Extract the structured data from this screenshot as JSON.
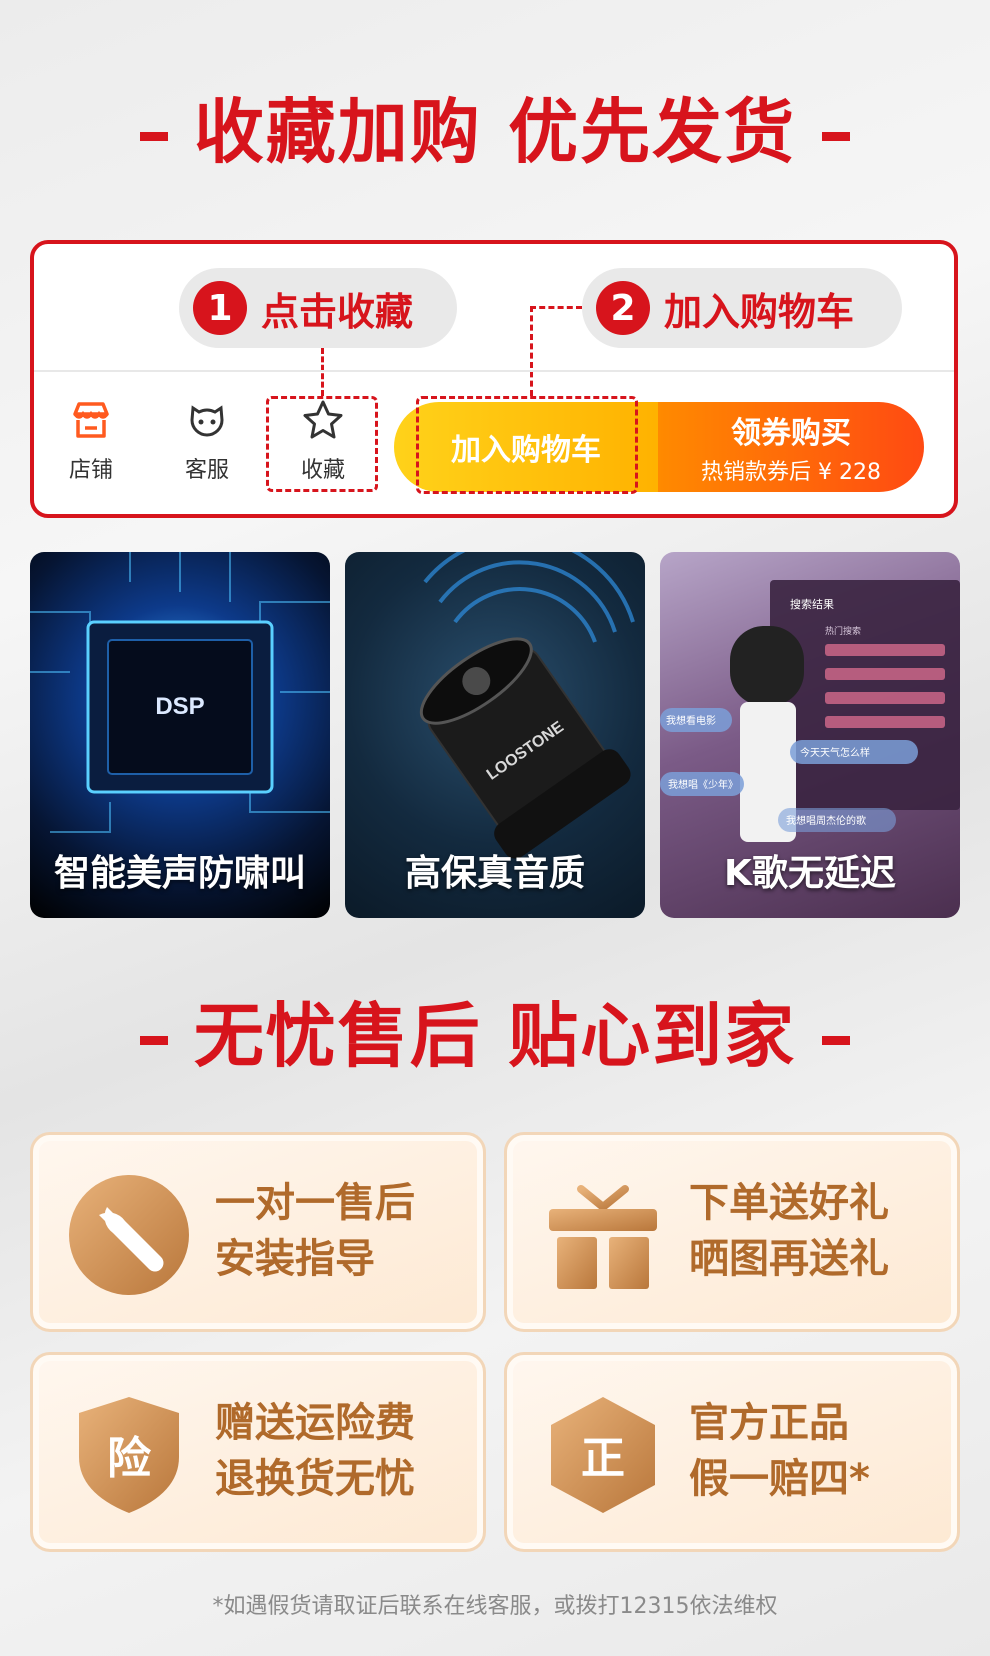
{
  "section1": {
    "title": "收藏加购 优先发货"
  },
  "steps": [
    {
      "num": "1",
      "label": "点击收藏"
    },
    {
      "num": "2",
      "label": "加入购物车"
    }
  ],
  "navbar": {
    "items": [
      {
        "label": "店铺",
        "icon": "store-icon"
      },
      {
        "label": "客服",
        "icon": "service-icon"
      },
      {
        "label": "收藏",
        "icon": "star-icon"
      }
    ],
    "cart_button": "加入购物车",
    "buy_button": {
      "main": "领券购买",
      "sub": "热销款券后 ¥ 228"
    }
  },
  "features": [
    {
      "label": "智能美声防啸叫",
      "chip_text": "DSP"
    },
    {
      "label": "高保真音质",
      "brand_text": "LOOSTONE"
    },
    {
      "label": "K歌无延迟",
      "screen_title": "搜索结果",
      "screen_sub": "热门搜索",
      "bubbles": [
        "我想看电影",
        "今天天气怎么样",
        "我想唱《少年》",
        "我想唱周杰伦的歌"
      ]
    }
  ],
  "section2": {
    "title": "无忧售后 贴心到家"
  },
  "services": [
    {
      "line1": "一对一售后",
      "line2": "安装指导",
      "icon": "wrench-icon"
    },
    {
      "line1": "下单送好礼",
      "line2": "晒图再送礼",
      "icon": "gift-icon"
    },
    {
      "line1": "赠送运险费",
      "line2": "退换货无忧",
      "icon": "shield-icon",
      "badge_text": "险"
    },
    {
      "line1": "官方正品",
      "line2": "假一赔四*",
      "icon": "hexagon-icon",
      "badge_text": "正"
    }
  ],
  "footnote": "*如遇假货请取证后联系在线客服，或拨打12315依法维权",
  "colors": {
    "brand_red": "#d7141c",
    "gold": "#b06a2b"
  }
}
